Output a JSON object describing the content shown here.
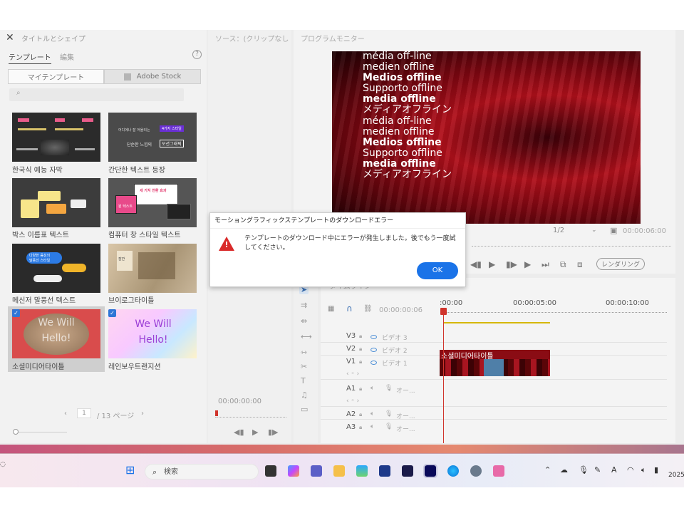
{
  "left_panel": {
    "title": "タイトルとシェイプ",
    "tabs": [
      "テンプレート",
      "編集"
    ],
    "segments": [
      "マイテンプレート",
      "Adobe Stock"
    ],
    "templates": [
      {
        "label": "한국식 예능 자막",
        "checked": false
      },
      {
        "label": "간단한 텍스트 등장",
        "checked": false
      },
      {
        "label": "박스 이름표 텍스트",
        "checked": false
      },
      {
        "label": "컴퓨터 창 스타일 텍스트",
        "checked": false
      },
      {
        "label": "메신저 말풍선 텍스트",
        "checked": false
      },
      {
        "label": "브이로그타이틀",
        "checked": false
      },
      {
        "label": "소셜미디어타이틀",
        "checked": true
      },
      {
        "label": "레인보우트랜지션",
        "checked": true
      }
    ],
    "thumb_texts": {
      "t2_line1": "어디에나 잘 어울리는",
      "t2_badge": "4가지 스타일",
      "t2_line2": "단순한 느낌의",
      "t2_line3": "모션그래픽",
      "t4_line1": "세 가지 전환 효과",
      "t4_line2": "원 텍스트",
      "t5_line1": "다양한 음성의",
      "t5_line2": "말풍선 스타일",
      "t6_text": "잠깐",
      "t7_text": "We Will Hello!",
      "t8_text": "We Will Hello!"
    },
    "pager": {
      "current": "1",
      "total": "/ 13 ページ"
    }
  },
  "source_panel": {
    "title": "ソース：(クリップなし",
    "timecode": "00:00:00:00"
  },
  "program_monitor": {
    "title": "プログラムモニター",
    "lines": [
      {
        "text": "média off-line",
        "bold": false
      },
      {
        "text": "medien offline",
        "bold": false
      },
      {
        "text": "Medios offline",
        "bold": true
      },
      {
        "text": "Supporto offline",
        "bold": false
      },
      {
        "text": "media offline",
        "bold": true
      },
      {
        "text": "メディアオフライン",
        "bold": false
      },
      {
        "text": "média off-line",
        "bold": false
      },
      {
        "text": "medien offline",
        "bold": false
      },
      {
        "text": "Medios offline",
        "bold": true
      },
      {
        "text": "Supporto offline",
        "bold": false
      },
      {
        "text": "media offline",
        "bold": true
      },
      {
        "text": "メディアオフライン",
        "bold": false
      }
    ],
    "fraction": "1/2",
    "timecode": "00:00:06:00",
    "render_label": "レンダリング"
  },
  "timeline": {
    "title": "タイムライン",
    "timecode": "00:00:00:06",
    "ruler": [
      ":00:00",
      "00:00:05:00",
      "00:00:10:00"
    ],
    "tracks": [
      {
        "name": "V3",
        "sub": "ビデオ 3"
      },
      {
        "name": "V2",
        "sub": "ビデオ 2"
      },
      {
        "name": "V1",
        "sub": "ビデオ 1"
      },
      {
        "name": "A1",
        "sub": "オー..."
      },
      {
        "name": "A2",
        "sub": "オー..."
      },
      {
        "name": "A3",
        "sub": "オー..."
      }
    ],
    "clip_label": "소셜미디어타이틀"
  },
  "dialog": {
    "title": "モーショングラフィックステンプレートのダウンロードエラー",
    "message": "テンプレートのダウンロード中にエラーが発生しました。後でもう一度試してください。",
    "ok_label": "OK"
  },
  "taskbar": {
    "search_placeholder": "検索",
    "year": "2025"
  },
  "colors": {
    "accent": "#1a73e8",
    "error": "#d92a2a",
    "playhead": "#d0342c"
  }
}
